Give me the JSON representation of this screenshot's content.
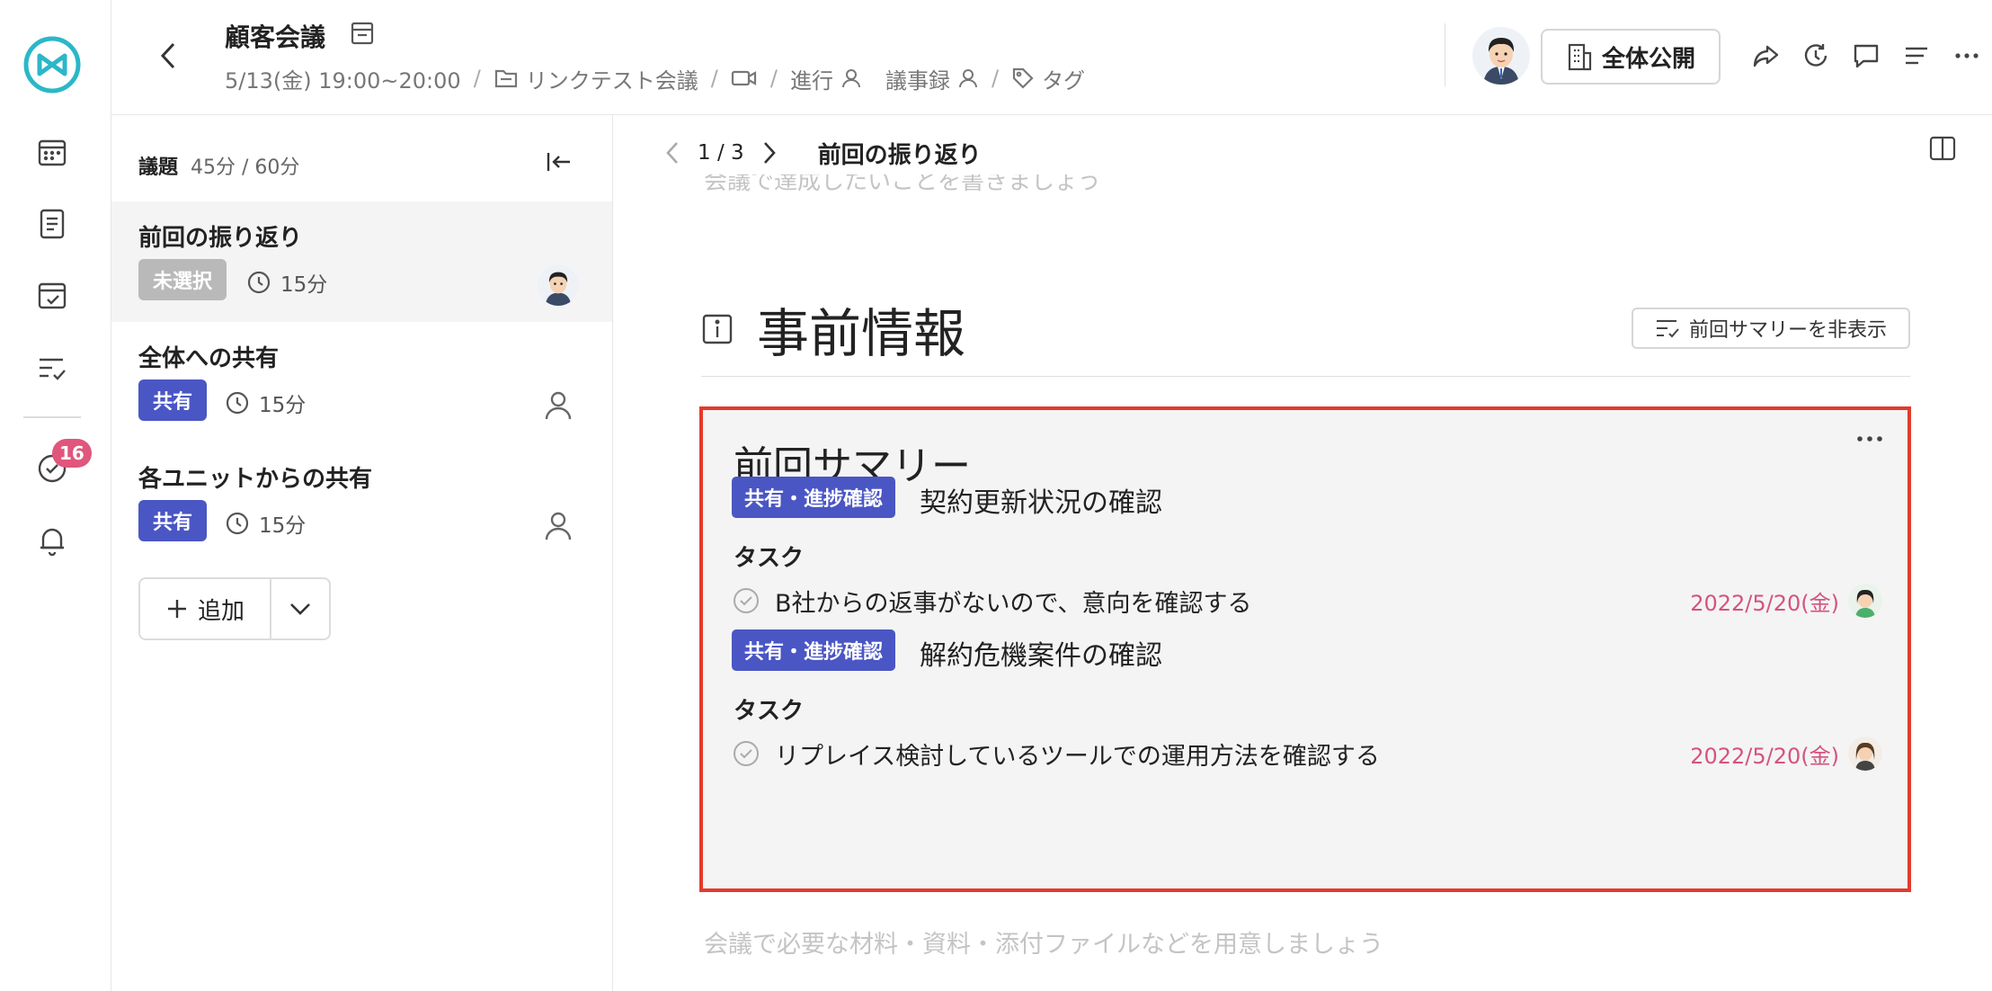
{
  "sidebar": {
    "badge_count": "16",
    "icons": [
      "app-logo-icon",
      "calendar-icon",
      "document-icon",
      "calendar-check-icon",
      "task-list-icon",
      "todo-check-icon",
      "bell-icon"
    ]
  },
  "header": {
    "title": "顧客会議",
    "datetime": "5/13(金) 19:00~20:00",
    "folder": "リンクテスト会議",
    "facilitator_label": "進行",
    "minutes_label": "議事録",
    "tag_label": "タグ",
    "visibility_button": "全体公開"
  },
  "agenda": {
    "label": "議題",
    "time_summary": "45分 / 60分",
    "items": [
      {
        "title": "前回の振り返り",
        "status": "未選択",
        "duration": "15分"
      },
      {
        "title": "全体への共有",
        "status": "共有",
        "duration": "15分"
      },
      {
        "title": "各ユニットからの共有",
        "status": "共有",
        "duration": "15分"
      }
    ],
    "add_label": "追加"
  },
  "main": {
    "page_indicator": "1 / 3",
    "page_title": "前回の振り返り",
    "goal_placeholder": "会議で達成したいことを書きましょう",
    "section_title": "事前情報",
    "hide_summary_button": "前回サマリーを非表示",
    "materials_placeholder": "会議で必要な材料・資料・添付ファイルなどを用意しましょう"
  },
  "summary": {
    "title": "前回サマリー",
    "topics": [
      {
        "tag": "共有・進捗確認",
        "title": "契約更新状況の確認",
        "task_label": "タスク",
        "task": "B社からの返事がないので、意向を確認する",
        "due": "2022/5/20(金)"
      },
      {
        "tag": "共有・進捗確認",
        "title": "解約危機案件の確認",
        "task_label": "タスク",
        "task": "リプレイス検討しているツールでの運用方法を確認する",
        "due": "2022/5/20(金)"
      }
    ]
  },
  "colors": {
    "accent_blue": "#4a56c4",
    "logo_teal": "#2bb7c9",
    "highlight_red": "#e23b2c",
    "due_pink": "#d5537f",
    "badge_pink": "#e0567c"
  }
}
